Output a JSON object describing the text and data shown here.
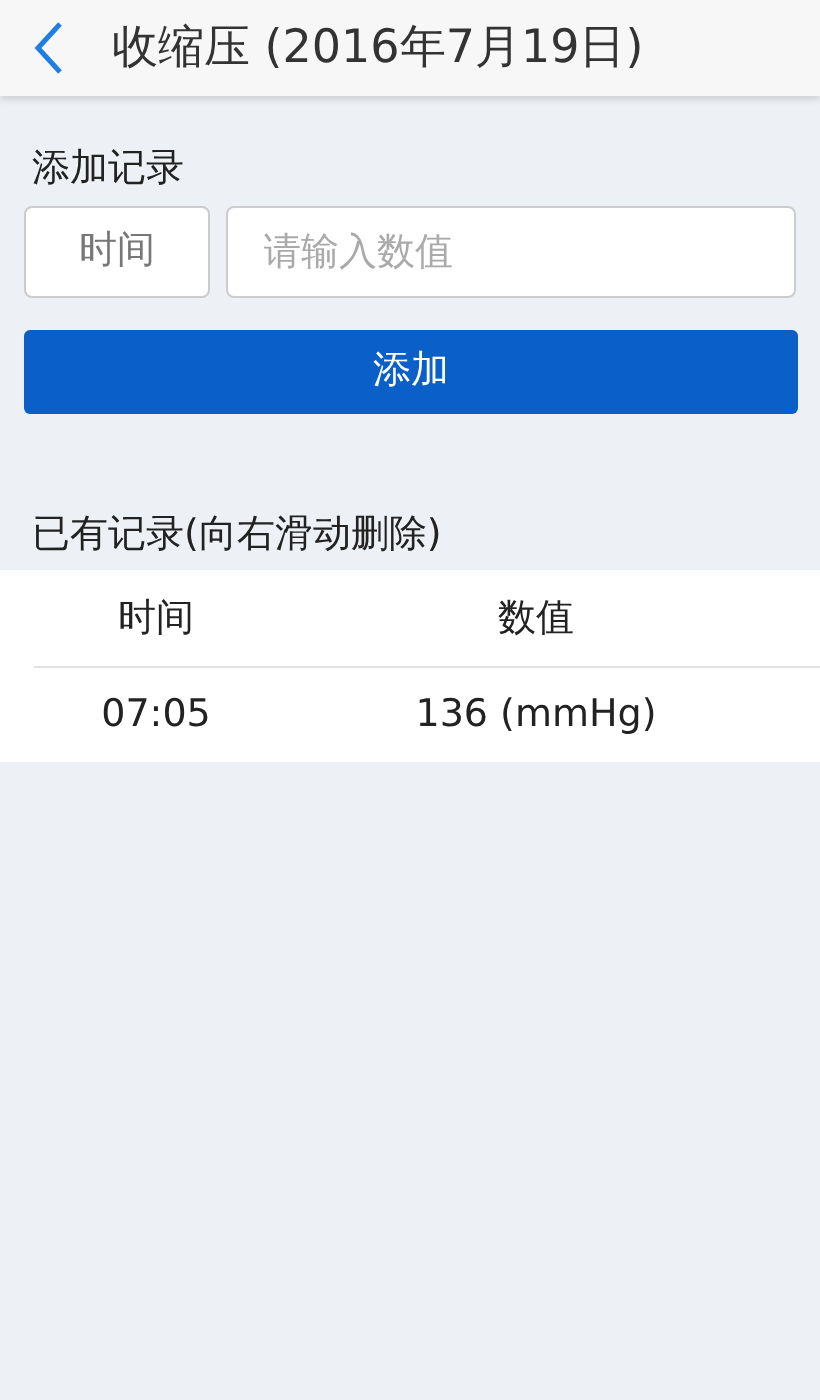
{
  "header": {
    "title": "收缩压 (2016年7月19日)"
  },
  "add_section": {
    "title": "添加记录",
    "time_button": "时间",
    "value_field": {
      "placeholder": "请输入数值"
    },
    "add_button": "添加"
  },
  "records": {
    "title": "已有记录(向右滑动删除)",
    "columns": [
      "时间",
      "数值"
    ],
    "rows": [
      [
        "07:05",
        "136 (mmHg)"
      ]
    ]
  }
}
